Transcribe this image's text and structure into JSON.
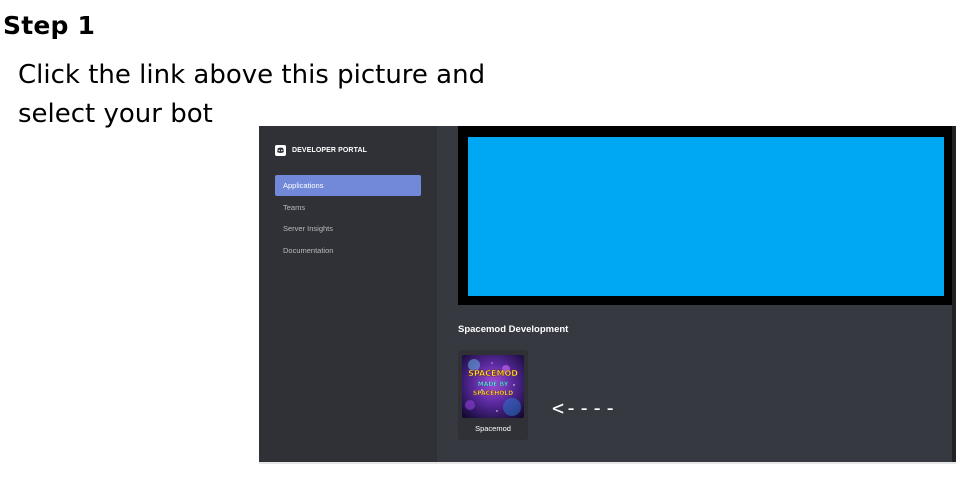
{
  "step": {
    "title": "Step 1"
  },
  "instruction": {
    "text": "Click the link above this picture and select your bot"
  },
  "portal": {
    "brand": {
      "icon": "discord-logo-icon",
      "label": "DEVELOPER PORTAL"
    },
    "nav": [
      {
        "label": "Applications",
        "active": true
      },
      {
        "label": "Teams",
        "active": false
      },
      {
        "label": "Server Insights",
        "active": false
      },
      {
        "label": "Documentation",
        "active": false
      }
    ],
    "section_heading": "Spacemod Development",
    "app": {
      "name": "Spacemod",
      "icon": "spacemod-app-icon",
      "icon_text_lines": [
        "SPACEMOD",
        "MADE BY",
        "SPACEHOLD"
      ]
    },
    "arrow_annotation": "<----"
  },
  "colors": {
    "sidebar": "#2f3136",
    "main": "#36393f",
    "active_nav": "#7289da",
    "blue_panel": "#00a8f3"
  }
}
